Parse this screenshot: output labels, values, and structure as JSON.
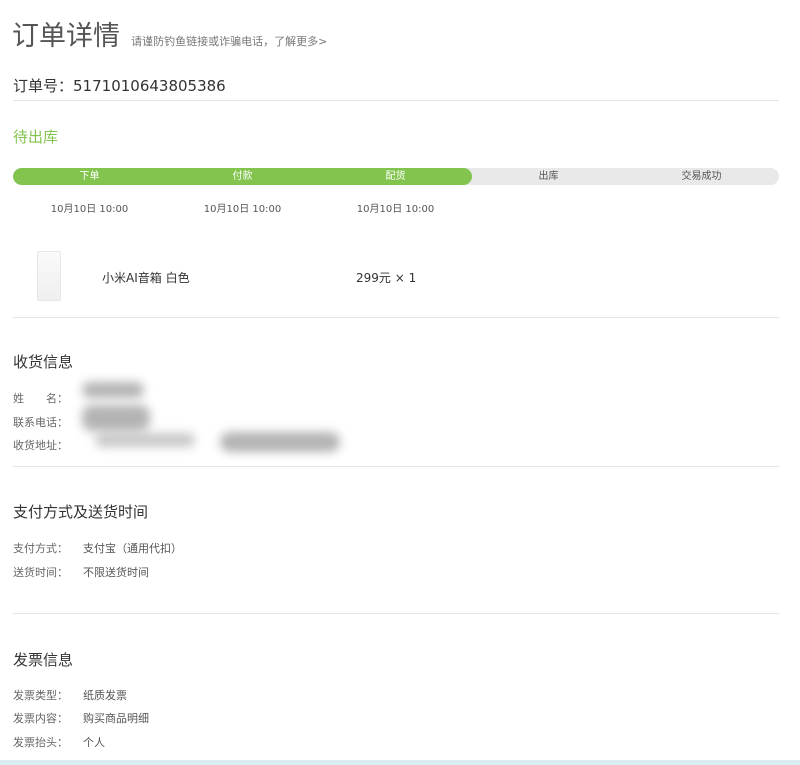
{
  "header": {
    "title": "订单详情",
    "notice": "请谨防钓鱼链接或诈骗电话，了解更多>"
  },
  "order": {
    "number_label": "订单号：",
    "number": "5171010643805386",
    "status": "待出库"
  },
  "progress": {
    "completed_steps": 3,
    "accent": "#83c44e",
    "steps": [
      {
        "label": "下单",
        "time": "10月10日 10:00"
      },
      {
        "label": "付款",
        "time": "10月10日 10:00"
      },
      {
        "label": "配货",
        "time": "10月10日 10:00"
      },
      {
        "label": "出库",
        "time": ""
      },
      {
        "label": "交易成功",
        "time": ""
      }
    ]
  },
  "product": {
    "image_icon": "speaker-product-image",
    "name": "小米AI音箱 白色",
    "price": "299元 × 1"
  },
  "shipping": {
    "title": "收货信息",
    "name_label": "姓　　名：",
    "phone_label": "联系电话：",
    "address_label": "收货地址："
  },
  "payment": {
    "title": "支付方式及送货时间",
    "method_label": "支付方式：",
    "method_value": "支付宝（通用代扣）",
    "delivery_label": "送货时间：",
    "delivery_value": "不限送货时间"
  },
  "invoice": {
    "title": "发票信息",
    "type_label": "发票类型：",
    "type_value": "纸质发票",
    "content_label": "发票内容：",
    "content_value": "购买商品明细",
    "header_label": "发票抬头：",
    "header_value": "个人"
  }
}
